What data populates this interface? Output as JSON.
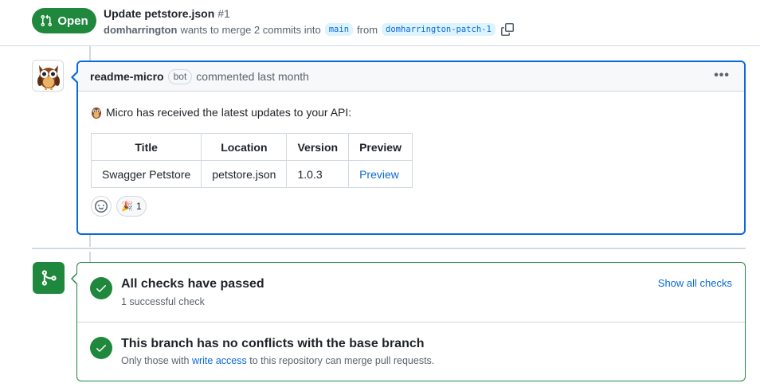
{
  "header": {
    "status": "Open",
    "title": "Update petstore.json",
    "number": "#1",
    "author": "domharrington",
    "merge_text": "wants to merge 2 commits into",
    "base_branch": "main",
    "from_text": "from",
    "head_branch": "domharrington-patch-1"
  },
  "comment": {
    "author": "readme-micro",
    "bot_label": "bot",
    "action": "commented last month",
    "menu": "•••",
    "intro": "Micro has received the latest updates to your API:",
    "table": {
      "headers": [
        "Title",
        "Location",
        "Version",
        "Preview"
      ],
      "row": [
        "Swagger Petstore",
        "petstore.json",
        "1.0.3",
        "Preview"
      ]
    },
    "reactions": [
      {
        "emoji": "🎉",
        "count": "1"
      }
    ]
  },
  "merge": {
    "checks_title": "All checks have passed",
    "checks_sub": "1 successful check",
    "show_all": "Show all checks",
    "conflicts_title": "This branch has no conflicts with the base branch",
    "conflicts_sub_pre": "Only those with",
    "conflicts_link": "write access",
    "conflicts_sub_post": "to this repository can merge pull requests."
  },
  "colors": {
    "open_green": "#1f883d",
    "link_blue": "#0969da",
    "border": "#d1d9e0"
  }
}
